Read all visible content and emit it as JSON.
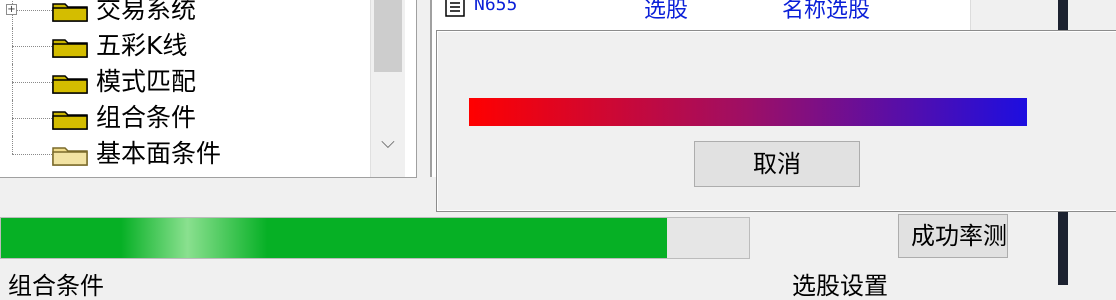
{
  "tree": {
    "items": [
      {
        "label": "交易系统",
        "expandable": true,
        "expander": "+"
      },
      {
        "label": "五彩K线",
        "expandable": false
      },
      {
        "label": "模式匹配",
        "expandable": false
      },
      {
        "label": "组合条件",
        "expandable": false
      },
      {
        "label": "基本面条件",
        "expandable": false
      }
    ]
  },
  "list": {
    "row": {
      "code": "N655",
      "col2": "选股",
      "col3": "名称选股"
    }
  },
  "dialog": {
    "cancel_label": "取消",
    "gradient_colors": [
      "#ff0000",
      "#9d0f66",
      "#1d0ee0"
    ]
  },
  "bottom": {
    "progress_fraction": 0.89,
    "progress_color": "#06b025",
    "success_button_label": "成功率测",
    "left_label": "组合条件",
    "right_label": "选股设置"
  },
  "icons": {
    "folder": "folder-icon",
    "list_row_icon": "formula-icon",
    "scroll_down": "chevron-down-icon"
  }
}
